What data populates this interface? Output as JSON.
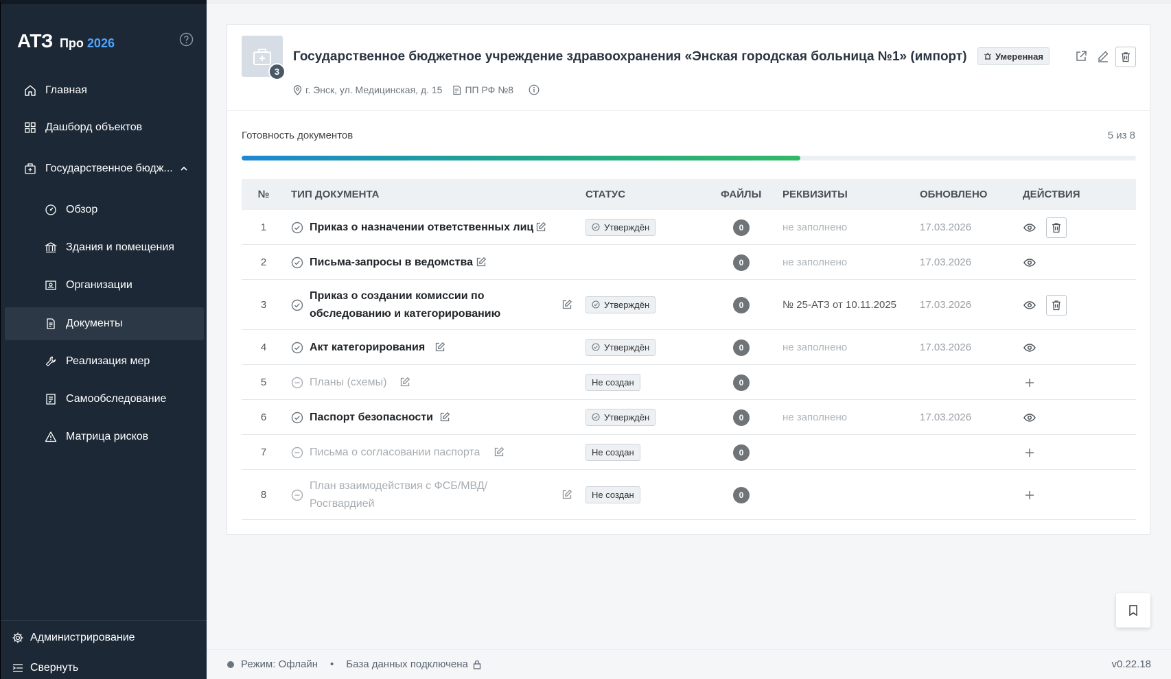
{
  "app": {
    "name_main": "АТЗ",
    "name_pro": "Про",
    "name_year": "2026"
  },
  "nav": {
    "home": "Главная",
    "dashboard": "Дашборд объектов",
    "object": "Государственное бюдж...",
    "overview": "Обзор",
    "buildings": "Здания и помещения",
    "organizations": "Организации",
    "documents": "Документы",
    "measures": "Реализация мер",
    "self_check": "Самообследование",
    "risk_matrix": "Матрица рисков",
    "admin": "Администрирование",
    "collapse": "Свернуть"
  },
  "object": {
    "title": "Государственное бюджетное учреждение здравоохранения «Энская городская больница №1» (импорт)",
    "badge_count": "3",
    "risk": "Умеренная",
    "address": "г. Энск, ул. Медицинская, д. 15",
    "regulation": "ПП РФ №8"
  },
  "readiness": {
    "label": "Готовность документов",
    "count_text": "5 из 8",
    "done": 5,
    "total": 8
  },
  "table": {
    "headers": {
      "num": "№",
      "type": "ТИП ДОКУМЕНТА",
      "status": "СТАТУС",
      "files": "ФАЙЛЫ",
      "requisites": "РЕКВИЗИТЫ",
      "updated": "ОБНОВЛЕНО",
      "actions": "ДЕЙСТВИЯ"
    },
    "rows": [
      {
        "num": "1",
        "name": "Приказ о назначении ответственных лиц",
        "status": "Утверждён",
        "files": "0",
        "requisites": "не заполнено",
        "updated": "17.03.2026"
      },
      {
        "num": "2",
        "name": "Письма-запросы в ведомства",
        "status": "",
        "files": "0",
        "requisites": "не заполнено",
        "updated": "17.03.2026"
      },
      {
        "num": "3",
        "name": "Приказ о создании комиссии по",
        "name2": "обследованию и категорированию",
        "status": "Утверждён",
        "files": "0",
        "requisites": "№ 25-АТЗ от 10.11.2025",
        "updated": "17.03.2026"
      },
      {
        "num": "4",
        "name": "Акт категорирования",
        "status": "Утверждён",
        "files": "0",
        "requisites": "не заполнено",
        "updated": "17.03.2026"
      },
      {
        "num": "5",
        "name": "Планы (схемы)",
        "status": "Не создан",
        "files": "0",
        "requisites": "",
        "updated": ""
      },
      {
        "num": "6",
        "name": "Паспорт безопасности",
        "status": "Утверждён",
        "files": "0",
        "requisites": "не заполнено",
        "updated": "17.03.2026"
      },
      {
        "num": "7",
        "name": "Письма о согласовании паспорта",
        "status": "Не создан",
        "files": "0",
        "requisites": "",
        "updated": ""
      },
      {
        "num": "8",
        "name": "План взаимодействия с ФСБ/МВД/",
        "name2": "Росгвардией",
        "status": "Не создан",
        "files": "0",
        "requisites": "",
        "updated": ""
      }
    ]
  },
  "footer": {
    "mode": "Режим: Офлайн",
    "db": "База данных подключена",
    "version": "v0.22.18"
  },
  "colors": {
    "sidebar": "#1c2836",
    "accent": "#4ea4ff",
    "progress_start": "#1e88d2",
    "progress_end": "#34b866"
  }
}
